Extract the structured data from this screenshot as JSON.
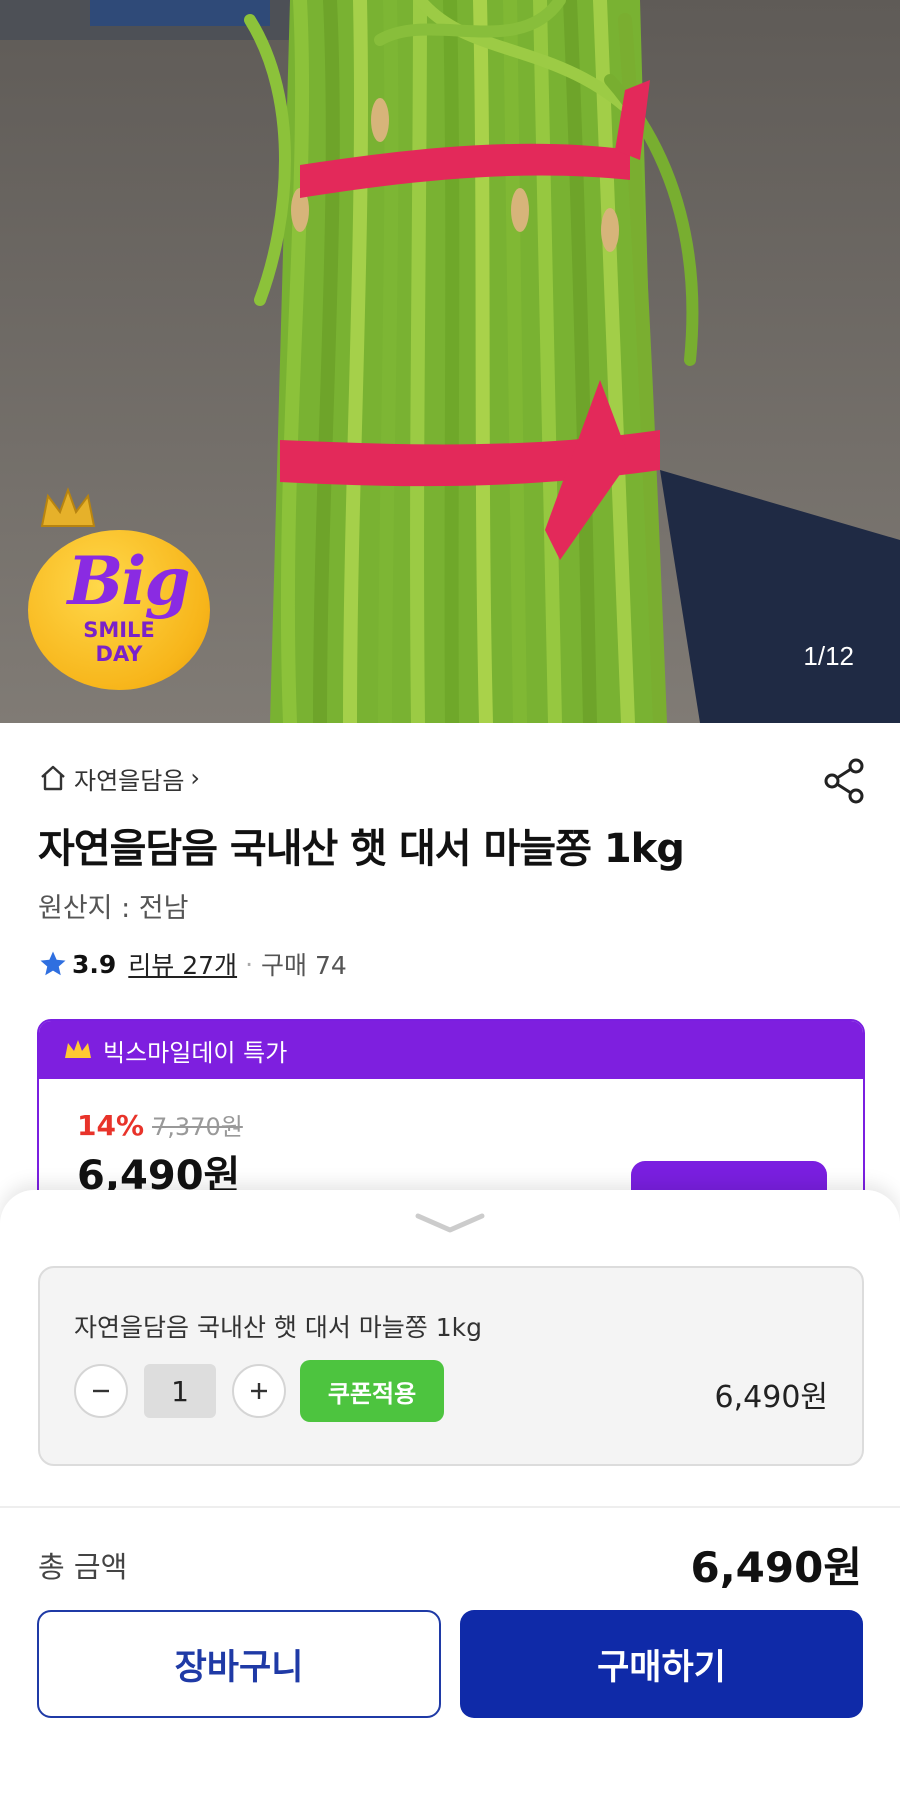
{
  "hero": {
    "image_counter": "1/12",
    "badge": {
      "big": "Big",
      "smile": "SMILE",
      "day": "DAY"
    }
  },
  "product": {
    "store_name": "자연을담음",
    "store_chevron": "›",
    "title": "자연을담음 국내산 햇 대서 마늘쫑 1kg",
    "origin": "원산지 : 전남",
    "rating": "3.9",
    "reviews": "리뷰 27개",
    "purchase_count": "구매 74"
  },
  "promo": {
    "label": "빅스마일데이 특가",
    "discount_rate": "14%",
    "original_price": "7,370원",
    "sale_price": "6,490원"
  },
  "sheet": {
    "option_name": "자연을담음 국내산 햇 대서 마늘쫑 1kg",
    "quantity": "1",
    "coupon_button": "쿠폰적용",
    "option_price": "6,490원",
    "total_label": "총 금액",
    "total_price": "6,490원",
    "cart_button": "장바구니",
    "buy_button": "구매하기"
  },
  "colors": {
    "promo_purple": "#7e1fdf",
    "buy_blue": "#0f2aa8",
    "coupon_green": "#4dc43f",
    "discount_red": "#e8332a"
  }
}
